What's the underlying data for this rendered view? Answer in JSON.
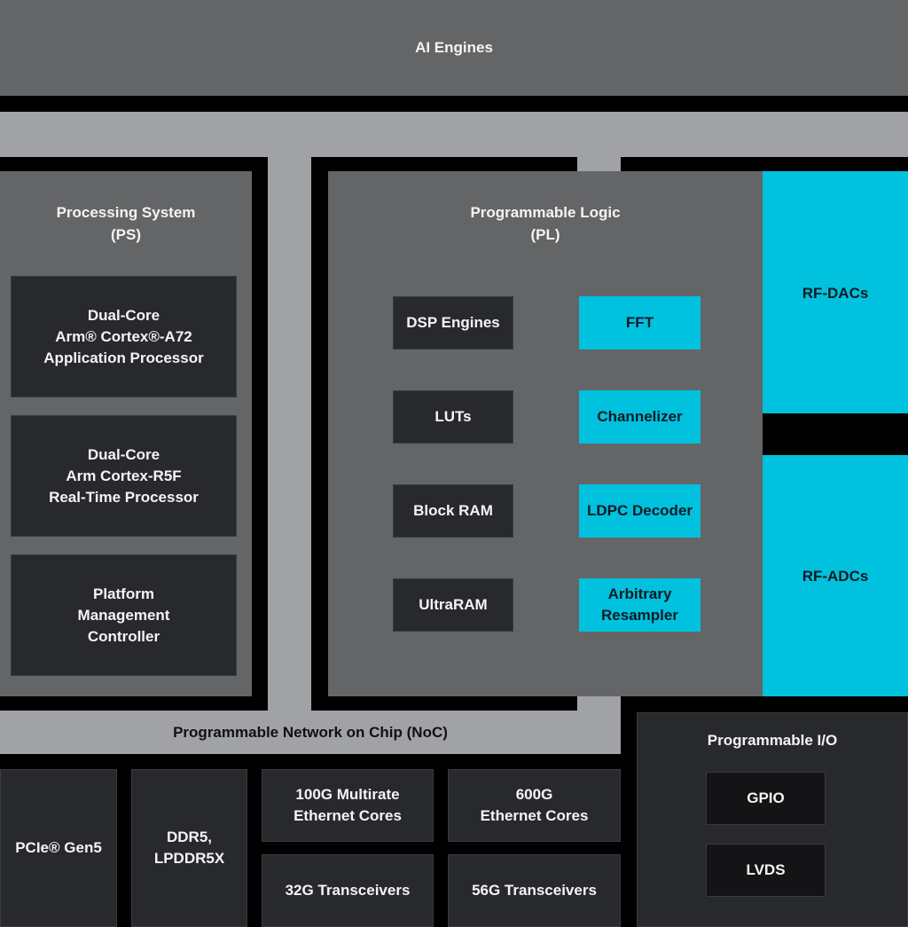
{
  "colors": {
    "accent_cyan": "#00c1de",
    "block_dark": "#28292d",
    "region_mid_grey": "#646567",
    "noc_light_grey": "#a1a2a5",
    "background_black": "#000000"
  },
  "ai_engines": {
    "label": "AI Engines"
  },
  "processing_system": {
    "title": "Processing System\n(PS)",
    "blocks": [
      {
        "label": "Dual-Core\nArm® Cortex®-A72\nApplication Processor"
      },
      {
        "label": "Dual-Core\nArm Cortex-R5F\nReal-Time Processor"
      },
      {
        "label": "Platform\nManagement\nController"
      }
    ]
  },
  "programmable_logic": {
    "title": "Programmable Logic\n(PL)",
    "left_blocks": [
      {
        "label": "DSP Engines"
      },
      {
        "label": "LUTs"
      },
      {
        "label": "Block RAM"
      },
      {
        "label": "UltraRAM"
      }
    ],
    "right_blocks": [
      {
        "label": "FFT"
      },
      {
        "label": "Channelizer"
      },
      {
        "label": "LDPC Decoder"
      },
      {
        "label": "Arbitrary\nResampler"
      }
    ]
  },
  "rf": {
    "dacs": {
      "label": "RF-DACs"
    },
    "adcs": {
      "label": "RF-ADCs"
    }
  },
  "noc": {
    "label": "Programmable Network on Chip (NoC)"
  },
  "bottom_blocks": {
    "pcie": {
      "label": "PCIe® Gen5"
    },
    "ddr": {
      "label": "DDR5,\nLPDDR5X"
    },
    "eth100": {
      "label": "100G Multirate\nEthernet Cores"
    },
    "eth600": {
      "label": "600G\nEthernet Cores"
    },
    "xcvr32": {
      "label": "32G Transceivers"
    },
    "xcvr56": {
      "label": "56G Transceivers"
    }
  },
  "programmable_io": {
    "title": "Programmable I/O",
    "blocks": [
      {
        "label": "GPIO"
      },
      {
        "label": "LVDS"
      }
    ]
  }
}
